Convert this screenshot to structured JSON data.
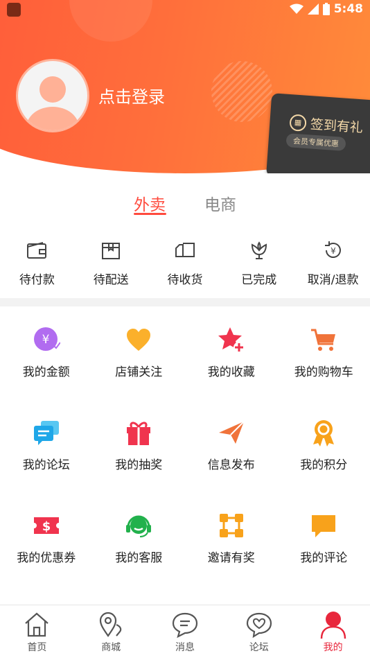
{
  "status": {
    "time": "5:48"
  },
  "header": {
    "login_text": "点击登录",
    "checkin_title": "签到有礼",
    "checkin_badge": "会员专属优惠"
  },
  "tabs": [
    {
      "label": "外卖",
      "active": true
    },
    {
      "label": "电商",
      "active": false
    }
  ],
  "orders": [
    {
      "label": "待付款",
      "icon": "wallet-icon"
    },
    {
      "label": "待配送",
      "icon": "box-icon"
    },
    {
      "label": "待收货",
      "icon": "truck-icon"
    },
    {
      "label": "已完成",
      "icon": "flower-icon"
    },
    {
      "label": "取消/退款",
      "icon": "refund-icon"
    }
  ],
  "grid": [
    {
      "label": "我的金额",
      "icon": "yen-coin-icon"
    },
    {
      "label": "店铺关注",
      "icon": "heart-icon"
    },
    {
      "label": "我的收藏",
      "icon": "star-plus-icon"
    },
    {
      "label": "我的购物车",
      "icon": "cart-icon"
    },
    {
      "label": "我的论坛",
      "icon": "chat-bubbles-icon"
    },
    {
      "label": "我的抽奖",
      "icon": "gift-icon"
    },
    {
      "label": "信息发布",
      "icon": "paper-plane-icon"
    },
    {
      "label": "我的积分",
      "icon": "medal-icon"
    },
    {
      "label": "我的优惠券",
      "icon": "coupon-icon"
    },
    {
      "label": "我的客服",
      "icon": "headset-icon"
    },
    {
      "label": "邀请有奖",
      "icon": "share-nodes-icon"
    },
    {
      "label": "我的评论",
      "icon": "comment-icon"
    }
  ],
  "tabbar": [
    {
      "label": "首页",
      "icon": "home-icon",
      "active": false
    },
    {
      "label": "商城",
      "icon": "map-pin-icon",
      "active": false
    },
    {
      "label": "消息",
      "icon": "message-icon",
      "active": false
    },
    {
      "label": "论坛",
      "icon": "forum-heart-icon",
      "active": false
    },
    {
      "label": "我的",
      "icon": "profile-icon",
      "active": true
    }
  ],
  "colors": {
    "accent": "#ff4b3e",
    "header_start": "#ff5a3a",
    "header_end": "#ff8f3a"
  }
}
